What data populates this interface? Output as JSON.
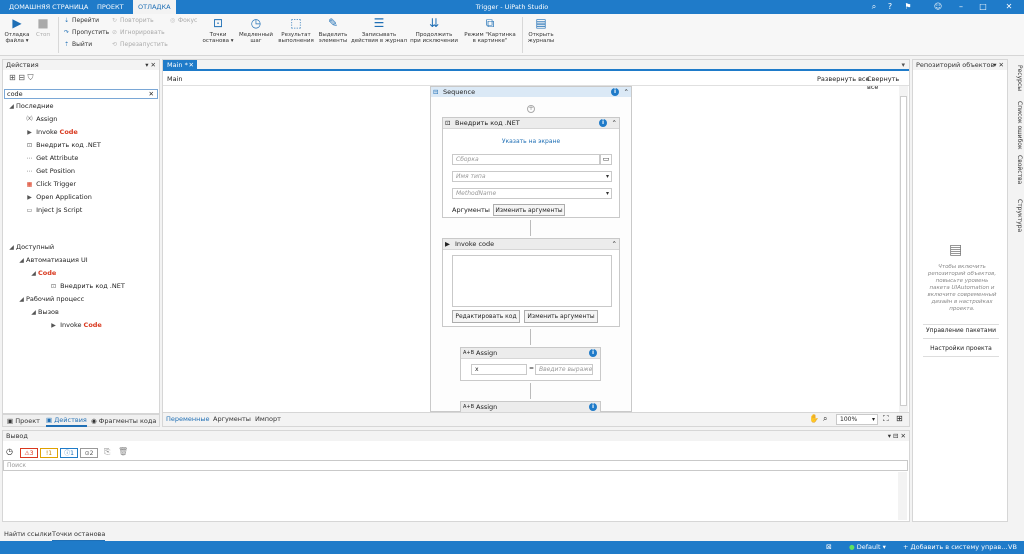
{
  "titlebar": {
    "tabs": [
      "ДОМАШНЯЯ СТРАНИЦА",
      "ПРОЕКТ",
      "ОТЛАДКА"
    ],
    "title": "Trigger - UiPath Studio"
  },
  "ribbon": {
    "debug_label": "Отладка\nфайла ▾",
    "stop_label": "Стоп",
    "small_col1": [
      "Перейти",
      "Пропустить",
      "Выйти"
    ],
    "small_col2": [
      "Повторить",
      "Игнорировать",
      "Перезапустить"
    ],
    "focus_label": "Фокус",
    "big": [
      "Точки\nостанова ▾",
      "Медленный\nшаг",
      "Результат\nвыполнения",
      "Выделить\nэлементы",
      "Записывать\nдействия в журнал",
      "Продолжить\nпри исключении",
      "Режим \"Картинка\nв картинке\"",
      "Открыть\nжурналы"
    ]
  },
  "actions_panel": {
    "title": "Действия",
    "search_value": "code",
    "recent_label": "Последние",
    "recent": [
      "Assign",
      "Invoke ",
      "Внедрить код .NET",
      "Get Attribute",
      "Get Position",
      "Click Trigger",
      "Open Application",
      "Inject Js Script"
    ],
    "invoke_hl": "Code",
    "available_label": "Доступный",
    "ui_auto": "Автоматизация UI",
    "code_group": "Code",
    "inject_net": "Внедрить код .NET",
    "workflow": "Рабочий процесс",
    "call": "Вызов",
    "invoke_prefix": "Invoke ",
    "invoke_code_hl": "Code",
    "bottom_tabs": [
      "Проект",
      "Действия",
      "Фрагменты кода"
    ]
  },
  "designer": {
    "tab": "Main *",
    "breadcrumb": "Main",
    "expand_all": "Развернуть все",
    "collapse_all": "Свернуть все",
    "sequence": "Sequence",
    "net_title": "Внедрить код .NET",
    "indicate": "Указать на экране",
    "assembly_ph": "Сборка",
    "type_ph": "Имя типа",
    "method_ph": "MethodName",
    "args_label": "Аргументы",
    "edit_args": "Изменить аргументы",
    "invoke_title": "Invoke code",
    "edit_code": "Редактировать код",
    "edit_args2": "Изменить аргументы",
    "assign_title": "Assign",
    "assign_to": "x",
    "assign_value_ph": "Введите выражение",
    "assign2_title": "Assign",
    "bottom_tabs": [
      "Переменные",
      "Аргументы",
      "Импорт"
    ],
    "zoom": "100%"
  },
  "repository": {
    "title": "Репозиторий объектов",
    "message": "Чтобы включить репозиторий объектов, повысьте уровень пакета UIAutomation и включите современный дизайн в настройках проекта.",
    "manage_packages": "Управление пакетами",
    "project_settings": "Настройки проекта",
    "side_tabs": [
      "Ресурсы",
      "Список ошибок",
      "Свойства",
      "Структура"
    ]
  },
  "output": {
    "title": "Вывод",
    "search_ph": "Поиск",
    "err": "3",
    "warn": "1",
    "info": "1",
    "trace": "2"
  },
  "bottom": {
    "tabs": [
      "Найти ссылки",
      "Точки останова"
    ]
  },
  "status": {
    "default": "Default",
    "vcs": "Добавить в систему управ...",
    "lang": "VB"
  }
}
